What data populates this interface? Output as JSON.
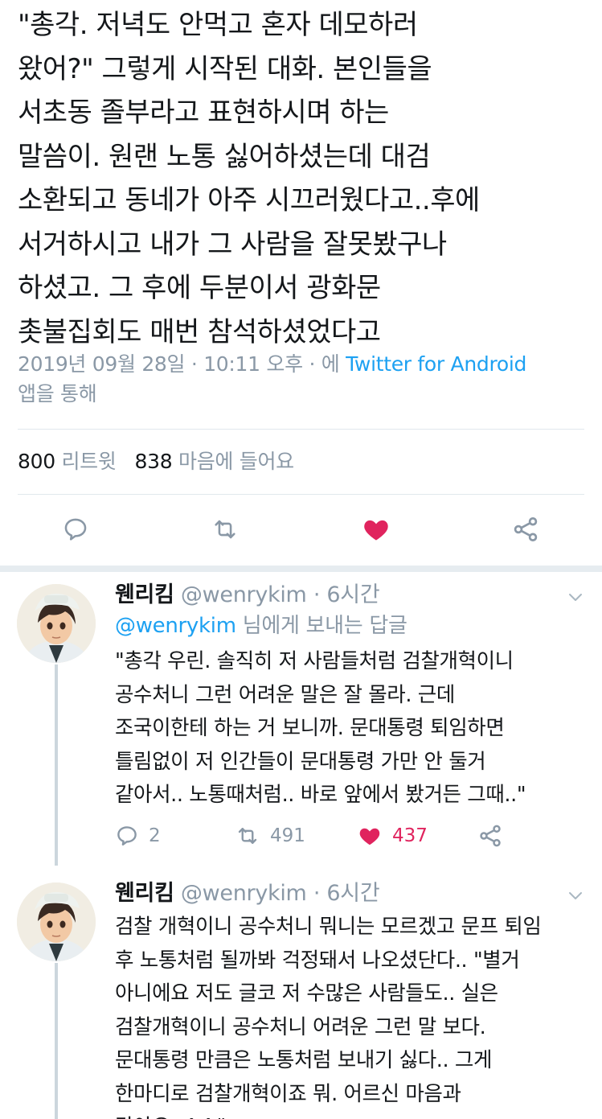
{
  "main_tweet": {
    "text": "\"총각. 저녁도 안먹고 혼자 데모하러\n왔어?\" 그렇게 시작된 대화. 본인들을\n서초동 졸부라고 표현하시며 하는\n말씀이. 원랜 노통 싫어하셨는데 대검\n소환되고 동네가 아주 시끄러웠다고..후에\n서거하시고 내가 그 사람을 잘못봤구나\n하셨고. 그 후에 두분이서 광화문\n촛불집회도 매번 참석하셨었다고",
    "date": "2019년 09월 28일",
    "dot1": " · ",
    "time": "10:11 오후",
    "dot2": " · 에 ",
    "source": "Twitter for Android",
    "via_suffix": "앱을 통해",
    "retweet_count": "800",
    "retweet_label": "리트윗",
    "like_count": "838",
    "like_label": "마음에 들어요"
  },
  "icons": {
    "reply": "reply-icon",
    "retweet": "retweet-icon",
    "like": "heart-icon",
    "share": "share-icon",
    "more": "chevron-down-icon"
  },
  "colors": {
    "accent": "#1da1f2",
    "like": "#e0245e",
    "muted": "#8a98a6",
    "text": "#14171a"
  },
  "replies": [
    {
      "name": "웬리킴",
      "handle": "@wenrykim",
      "time": " · 6시간",
      "reply_to_handle": "@wenrykim",
      "reply_to_suffix": " 님에게 보내는 답글",
      "text": "\"총각 우린. 솔직히 저 사람들처럼 검찰개혁이니\n공수처니 그런 어려운 말은 잘 몰라. 근데\n조국이한테 하는 거 보니까.  문대통령 퇴임하면\n틀림없이 저 인간들이 문대통령 가만 안 둘거\n같아서.. 노통때처럼.. 바로 앞에서 봤거든 그때..\"",
      "reply_count": "2",
      "retweet_count": "491",
      "like_count": "437"
    },
    {
      "name": "웬리킴",
      "handle": "@wenrykim",
      "time": " · 6시간",
      "text": "검찰 개혁이니 공수처니 뭐니는 모르겠고 문프 퇴임\n후 노통처럼 될까봐 걱정돼서 나오셨단다.. \"별거\n아니에요 저도 글코 저 수많은 사람들도.. 실은\n검찰개혁이니 공수처니 어려운 그런 말 보다.\n문대통령 만큼은 노통처럼 보내기 싫다.. 그게\n한마디로 검찰개혁이죠 뭐. 어르신 마음과\n같아요..^^\""
    }
  ]
}
